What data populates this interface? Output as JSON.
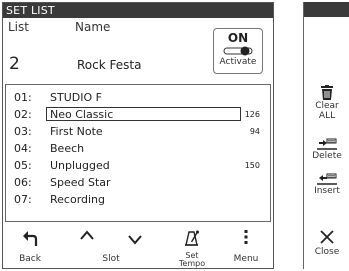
{
  "header": {
    "title": "SET LIST"
  },
  "info": {
    "list_label": "List",
    "name_label": "Name",
    "list_number": "2",
    "list_name": "Rock Festa",
    "activate": {
      "state": "ON",
      "label": "Activate"
    }
  },
  "songs": [
    {
      "num": "01:",
      "name": "STUDIO F",
      "tempo": ""
    },
    {
      "num": "02:",
      "name": "Neo Classic",
      "tempo": "126",
      "selected": true
    },
    {
      "num": "03:",
      "name": "First Note",
      "tempo": "94"
    },
    {
      "num": "04:",
      "name": "Beech",
      "tempo": ""
    },
    {
      "num": "05:",
      "name": "Unplugged",
      "tempo": "150"
    },
    {
      "num": "06:",
      "name": "Speed Star",
      "tempo": ""
    },
    {
      "num": "07:",
      "name": "Recording",
      "tempo": ""
    }
  ],
  "footer": {
    "back": {
      "label": "Back",
      "icon": "back-arrow-icon"
    },
    "slot": {
      "label": "Slot",
      "icon": "chevron-up-icon / chevron-down-icon"
    },
    "set_tempo": {
      "line1": "Set",
      "line2": "Tempo",
      "icon": "metronome-icon"
    },
    "menu": {
      "label": "Menu",
      "icon": "kebab-menu-icon"
    }
  },
  "side": {
    "clear_all": {
      "line1": "Clear",
      "line2": "ALL",
      "icon": "trash-icon"
    },
    "delete": {
      "label": "Delete",
      "icon": "delete-arrow-icon"
    },
    "insert": {
      "label": "Insert",
      "icon": "insert-arrow-icon"
    },
    "close": {
      "label": "Close",
      "icon": "close-icon"
    }
  }
}
